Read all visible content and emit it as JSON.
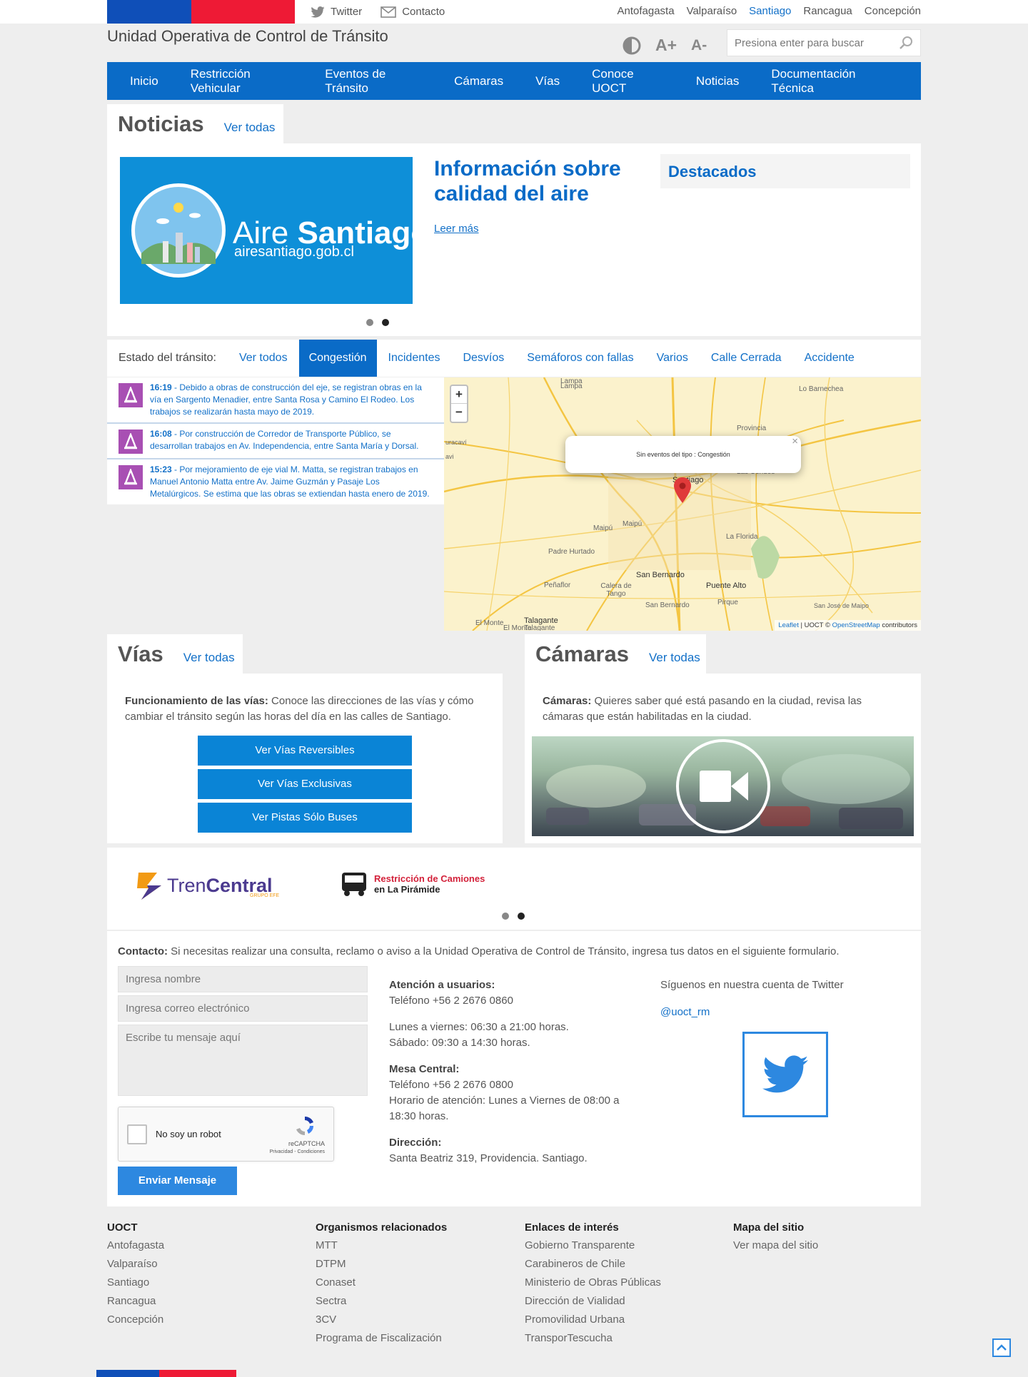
{
  "topbar": {
    "twitter_label": "Twitter",
    "contacto_label": "Contacto",
    "cities": [
      "Antofagasta",
      "Valparaíso",
      "Santiago",
      "Rancagua",
      "Concepción"
    ],
    "active_city": "Santiago"
  },
  "header": {
    "site_title": "Unidad Operativa de Control de Tránsito",
    "font_up": "A+",
    "font_down": "A-",
    "search_placeholder": "Presiona enter para buscar"
  },
  "nav": {
    "items": [
      "Inicio",
      "Restricción Vehicular",
      "Eventos de Tránsito",
      "Cámaras",
      "Vías",
      "Conoce UOCT",
      "Noticias",
      "Documentación Técnica"
    ]
  },
  "noticias": {
    "title": "Noticias",
    "see_all": "Ver todas",
    "banner_word1": "Aire",
    "banner_word2": "Santiago",
    "banner_url": "airesantiago.gob.cl",
    "headline": "Información sobre calidad del aire",
    "read_more": "Leer más",
    "destacados": "Destacados",
    "active_slide": 2
  },
  "transito": {
    "label": "Estado del tránsito:",
    "tabs": [
      "Ver todos",
      "Congestión",
      "Incidentes",
      "Desvíos",
      "Semáforos con fallas",
      "Varios",
      "Calle Cerrada",
      "Accidente"
    ],
    "selected_tab": "Congestión",
    "events": [
      {
        "time": "16:19",
        "text": " - Debido a obras de construcción del eje, se registran obras en la vía en Sargento Menadier, entre Santa Rosa y Camino El Rodeo. Los trabajos se realizarán hasta mayo de 2019."
      },
      {
        "time": "16:08",
        "text": " - Por construcción de Corredor de Transporte Público, se desarrollan trabajos en Av. Independencia, entre Santa María y Dorsal."
      },
      {
        "time": "15:23",
        "text": " - Por mejoramiento de eje vial M. Matta, se registran trabajos en Manuel Antonio Matta entre Av. Jaime Guzmán y Pasaje Los Metalúrgicos. Se estima que las obras se extiendan hasta enero de 2019."
      }
    ],
    "map": {
      "zoom_in": "+",
      "zoom_out": "−",
      "popup_text": "Sin eventos del tipo : Congestión",
      "popup_close": "×",
      "places": [
        "Lampa",
        "Lampa",
        "Lo Barnechea",
        "Provincia",
        "Las Condes",
        "Santiago",
        "Maipú",
        "Maipú",
        "La Florida",
        "Padre Hurtado",
        "Peñaflor",
        "Calera de Tango",
        "San Bernardo",
        "San Bernardo",
        "Puente Alto",
        "Pirque",
        "San José de Maipo",
        "El Monte",
        "El Monte",
        "Talagante",
        "Talagante",
        "uracaví",
        "avi"
      ],
      "attribution_leaflet": "Leaflet",
      "attribution_mid": " | UOCT © ",
      "attribution_osm": "OpenStreetMap",
      "attribution_end": " contributors"
    }
  },
  "vias": {
    "title": "Vías",
    "see_all": "Ver todas",
    "desc_bold": "Funcionamiento de las vías:",
    "desc": " Conoce las direcciones de las vías y cómo cambiar el tránsito según las horas del día en las calles de Santiago.",
    "buttons": [
      "Ver Vías Reversibles",
      "Ver Vías Exclusivas",
      "Ver Pistas Sólo Buses"
    ]
  },
  "camaras": {
    "title": "Cámaras",
    "see_all": "Ver todas",
    "desc_bold": "Cámaras:",
    "desc": " Quieres saber qué está pasando en la ciudad, revisa las cámaras que están habilitadas en la ciudad."
  },
  "banners": {
    "tren_word1": "Tren",
    "tren_word2": "Central",
    "tren_sub": "GRUPO EFE",
    "camiones_line1": "Restricción de Camiones",
    "camiones_line2": "en La Pirámide",
    "active_slide": 2
  },
  "contacto": {
    "intro_bold": "Contacto:",
    "intro": " Si necesitas realizar una consulta, reclamo o aviso a la Unidad Operativa de Control de Tránsito, ingresa tus datos en el siguiente formulario.",
    "name_placeholder": "Ingresa nombre",
    "email_placeholder": "Ingresa correo electrónico",
    "message_placeholder": "Escribe tu mensaje aquí",
    "captcha_label": "No soy un robot",
    "captcha_brand": "reCAPTCHA",
    "captcha_links": "Privacidad - Condiciones",
    "submit": "Enviar Mensaje",
    "atencion_title": "Atención a usuarios:",
    "atencion_phone": "Teléfono +56 2 2676 0860",
    "hours1": "Lunes a viernes: 06:30 a 21:00 horas.",
    "hours2": "Sábado: 09:30 a 14:30 horas.",
    "mesa_title": "Mesa Central:",
    "mesa_phone": "Teléfono +56 2 2676 0800",
    "mesa_hours": "Horario de atención: Lunes a Viernes de 08:00 a 18:30 horas.",
    "dir_title": "Dirección:",
    "dir": "Santa Beatriz 319, Providencia. Santiago.",
    "twitter_follow": "Síguenos en nuestra cuenta de Twitter",
    "twitter_handle": "@uoct_rm"
  },
  "footer": {
    "cols": [
      {
        "title": "UOCT",
        "items": [
          "Antofagasta",
          "Valparaíso",
          "Santiago",
          "Rancagua",
          "Concepción"
        ]
      },
      {
        "title": "Organismos relacionados",
        "items": [
          "MTT",
          "DTPM",
          "Conaset",
          "Sectra",
          "3CV",
          "Programa de Fiscalización"
        ]
      },
      {
        "title": "Enlaces de interés",
        "items": [
          "Gobierno Transparente",
          "Carabineros de Chile",
          "Ministerio de Obras Públicas",
          "Dirección de Vialidad",
          "Promovilidad Urbana",
          "TransporTescucha"
        ]
      },
      {
        "title": "Mapa del sitio",
        "items": [
          "Ver mapa del sitio"
        ]
      }
    ]
  },
  "colors": {
    "primary": "#0a6bc7",
    "event_icon": "#a84fb3",
    "flag_blue": "#0f4fb8",
    "flag_red": "#ee1a35"
  }
}
